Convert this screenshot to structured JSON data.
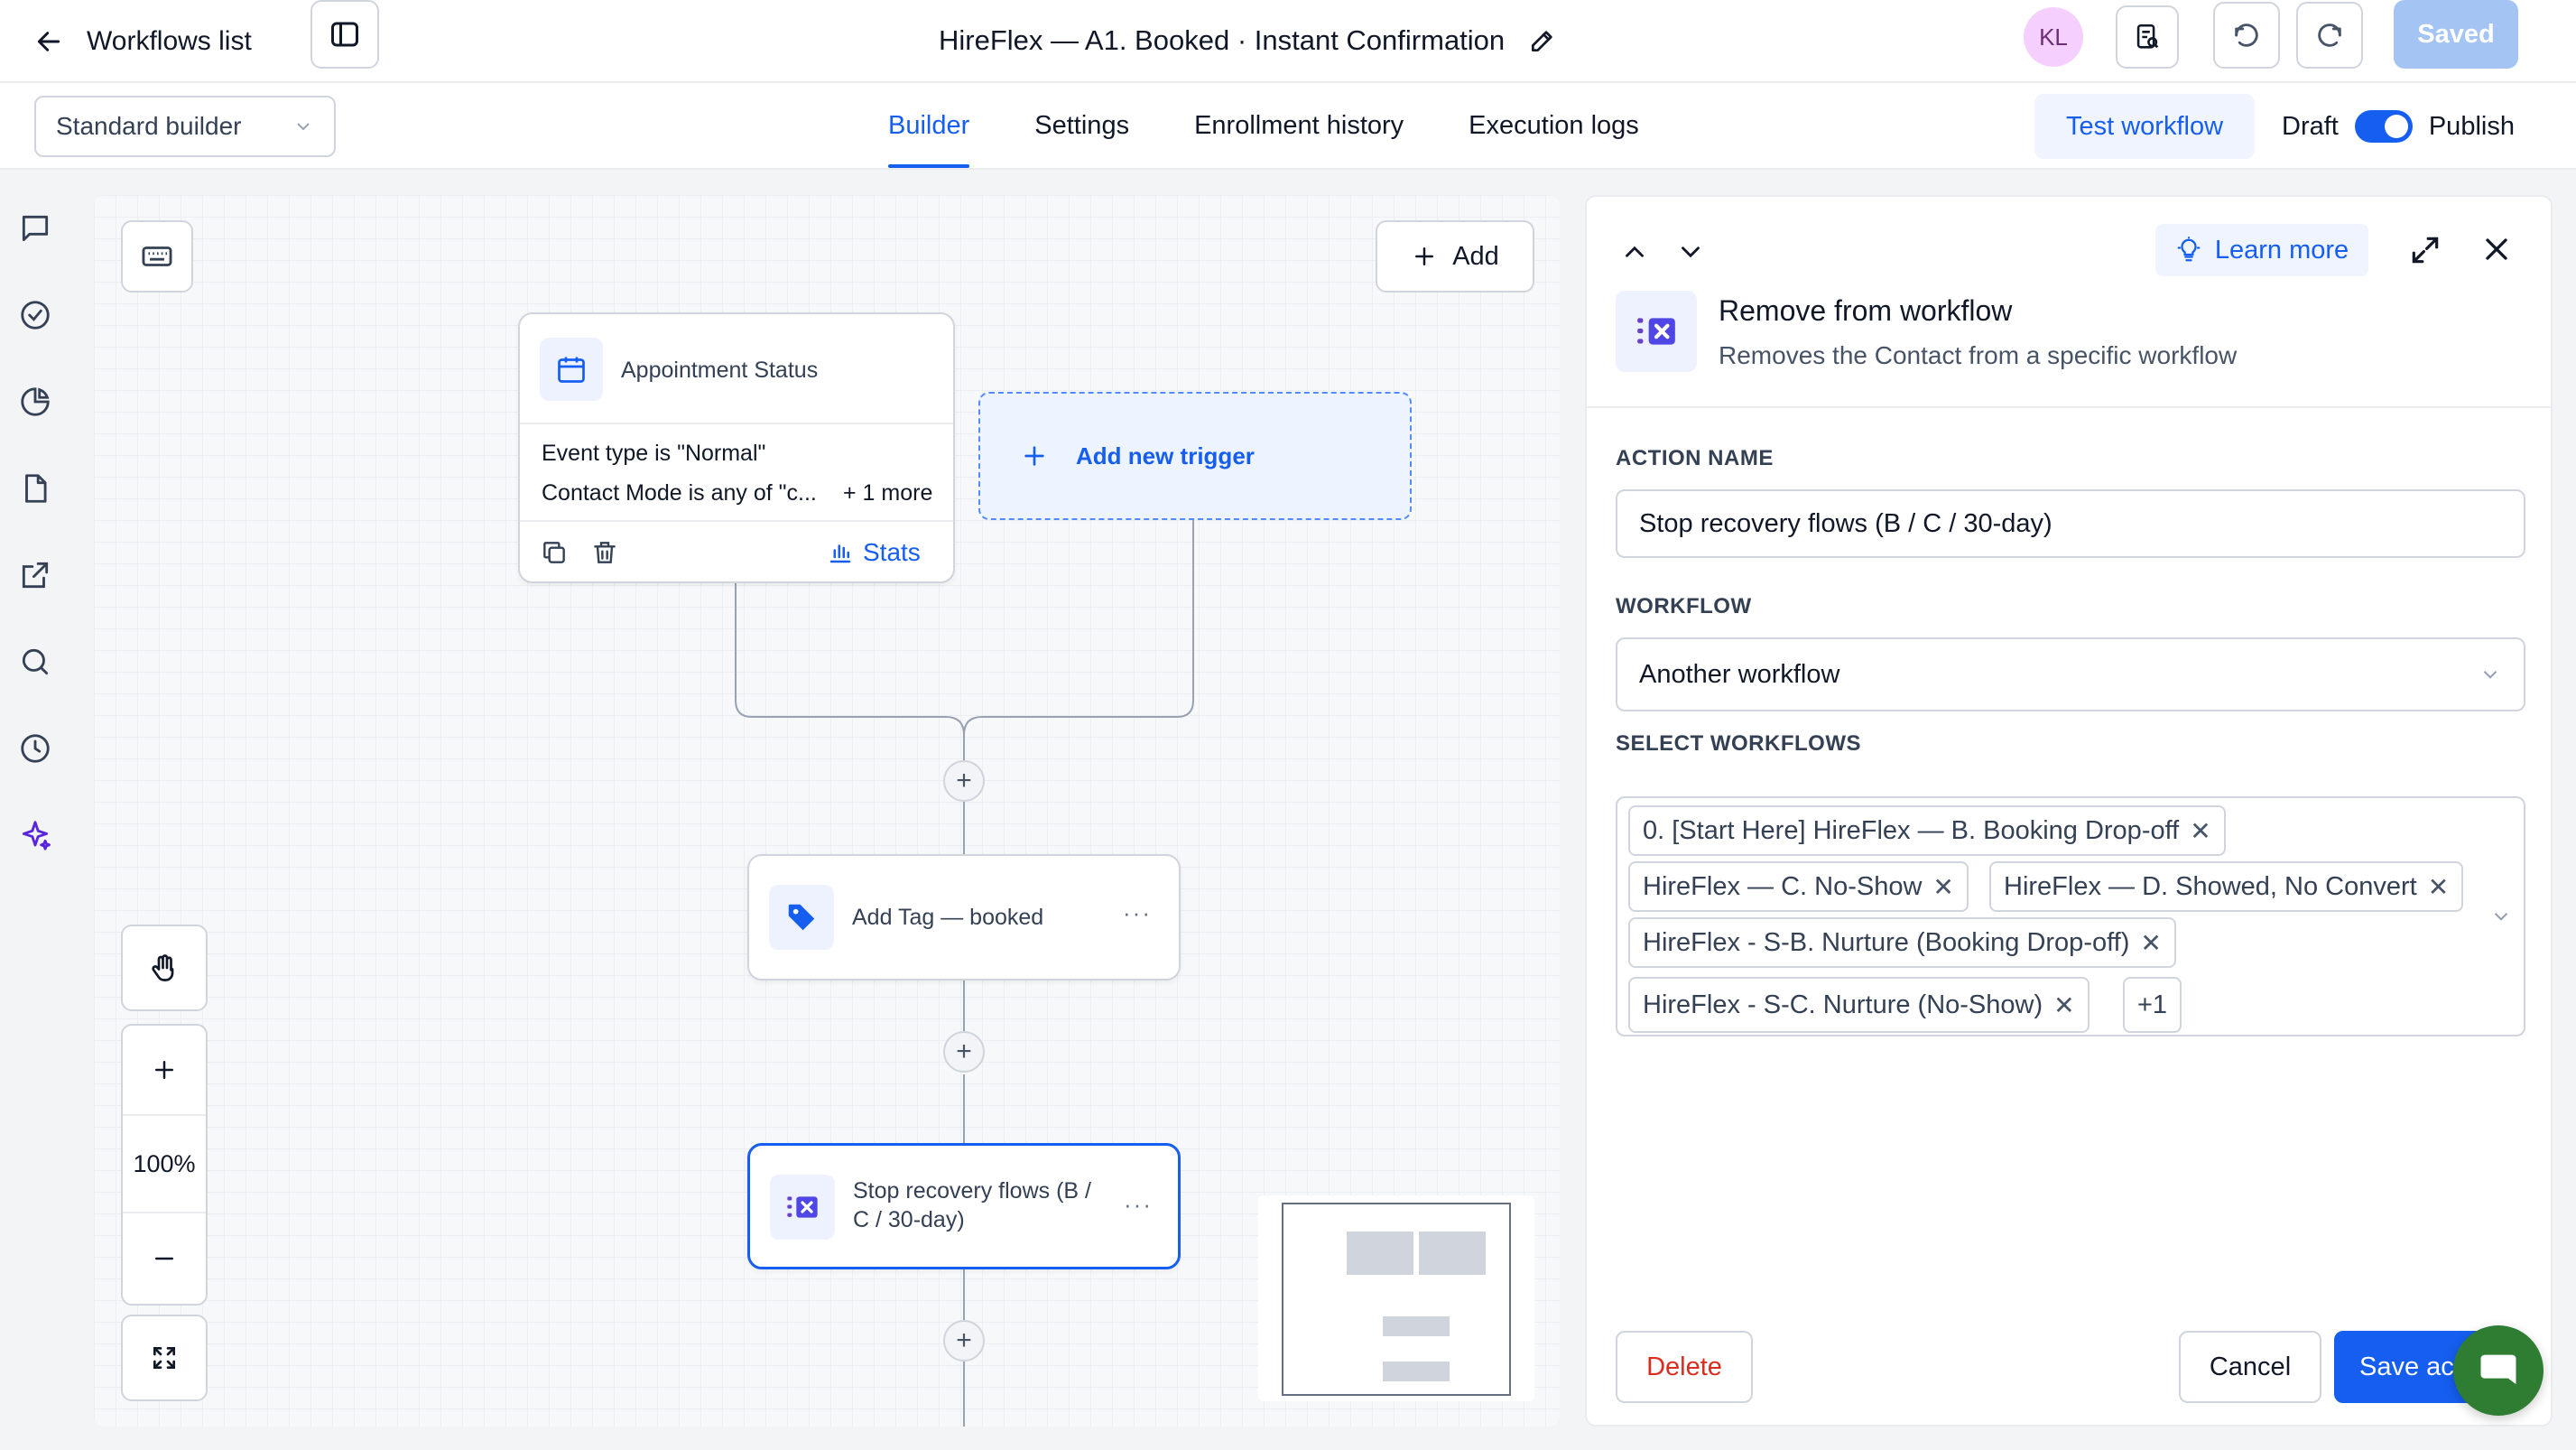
{
  "topbar": {
    "back_label": "Workflows list",
    "title": "HireFlex — A1. Booked · Instant Confirmation",
    "avatar_initials": "KL",
    "saved_label": "Saved"
  },
  "subbar": {
    "builder_select": "Standard builder",
    "tabs": [
      {
        "label": "Builder",
        "active": true
      },
      {
        "label": "Settings",
        "active": false
      },
      {
        "label": "Enrollment history",
        "active": false
      },
      {
        "label": "Execution logs",
        "active": false
      }
    ],
    "test_label": "Test workflow",
    "draft_label": "Draft",
    "publish_label": "Publish"
  },
  "canvas": {
    "add_label": "Add",
    "trigger": {
      "title": "Appointment Status",
      "condition_1": "Event type is \"Normal\"",
      "condition_2": "Contact Mode is any of \"c...",
      "more": "+ 1 more",
      "stats_label": "Stats"
    },
    "new_trigger_label": "Add new trigger",
    "action_tag": "Add Tag — booked",
    "action_stop_line1": "Stop recovery flows (B /",
    "action_stop_line2": "C / 30-day)",
    "zoom": "100%"
  },
  "panel": {
    "learn_more": "Learn more",
    "title": "Remove from workflow",
    "subtitle": "Removes the Contact from a specific workflow",
    "action_name_label": "ACTION NAME",
    "action_name_value": "Stop recovery flows (B / C / 30-day)",
    "workflow_label": "WORKFLOW",
    "workflow_value": "Another workflow",
    "select_label": "SELECT WORKFLOWS",
    "chips": [
      "0. [Start Here] HireFlex — B. Booking Drop-off",
      "HireFlex — C. No-Show",
      "HireFlex — D. Showed, No Convert",
      "HireFlex - S-B. Nurture (Booking Drop-off)",
      "HireFlex - S-C. Nurture (No-Show)"
    ],
    "more_chip": "+1",
    "delete_label": "Delete",
    "cancel_label": "Cancel",
    "save_label": "Save ac"
  },
  "colors": {
    "accent": "#155eef",
    "danger": "#d92d20",
    "chat_bubble": "#2e7d32"
  }
}
